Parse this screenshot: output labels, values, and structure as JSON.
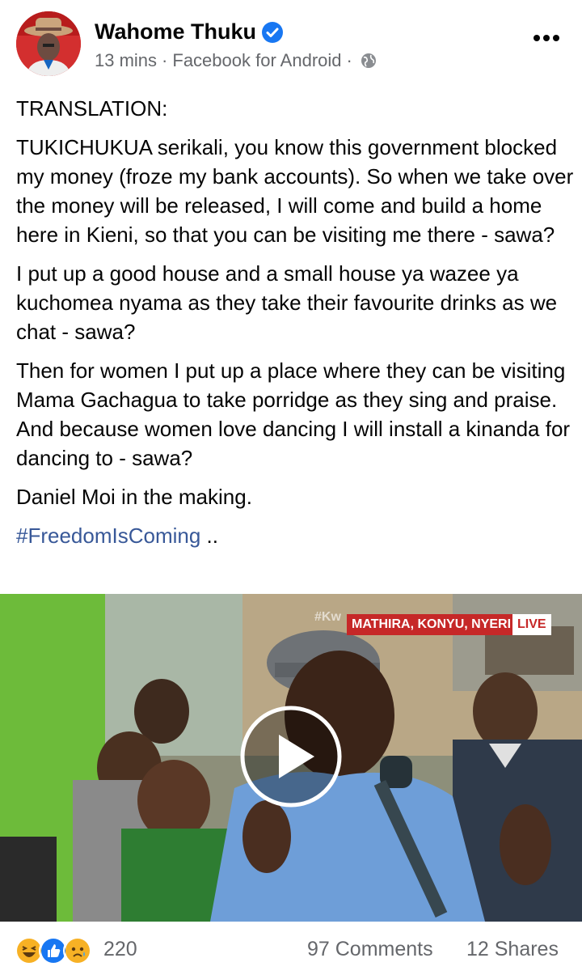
{
  "post": {
    "author": "Wahome Thuku",
    "time": "13 mins",
    "source": "Facebook for Android",
    "separator": "·",
    "paragraphs": [
      "TRANSLATION:",
      "TUKICHUKUA serikali, you know this government blocked my money (froze my bank accounts). So when we take over the money will be released, I will come and build a home here in Kieni, so that you can be visiting me there - sawa?",
      "I put up a good house and a small house ya wazee ya kuchomea nyama as they take their favourite drinks as we chat - sawa?",
      "Then for women I put up a place where they can be visiting Mama Gachagua to take porridge as they sing and praise. And because women love dancing I will install a kinanda for dancing to - sawa?",
      "Daniel Moi in the making."
    ],
    "hashtag": "#FreedomIsComing",
    "hashtag_suffix": " .."
  },
  "video": {
    "location_label": "MATHIRA, KONYU, NYERI",
    "live_label": "LIVE",
    "cap_text": "#Kw"
  },
  "footer": {
    "reaction_icons": [
      "haha-icon",
      "like-icon",
      "sad-icon"
    ],
    "reaction_count": "220",
    "comments": "97 Comments",
    "shares": "12 Shares"
  },
  "colors": {
    "verified_blue": "#1877f2",
    "link_blue": "#385898",
    "meta_gray": "#65676b",
    "live_red": "#c62828"
  }
}
